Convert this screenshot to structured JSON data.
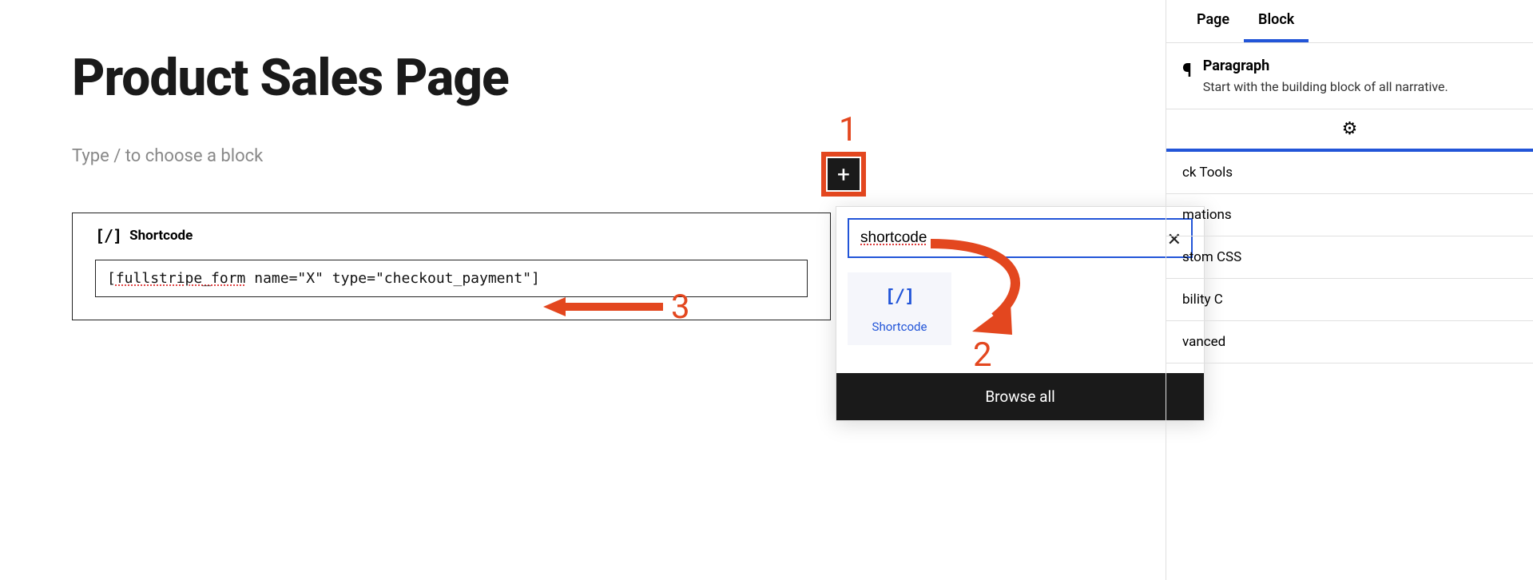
{
  "editor": {
    "page_title": "Product Sales Page",
    "placeholder": "Type / to choose a block",
    "shortcode_block": {
      "label": "Shortcode",
      "icon_text": "[/]",
      "input_value": "[fullstripe_form name=\"X\" type=\"checkout_payment\"]",
      "input_underlined": "fullstripe_form"
    }
  },
  "inserter": {
    "add_button": "+",
    "search_value": "shortcode",
    "close_icon": "✕",
    "result": {
      "icon_text": "[/]",
      "label": "Shortcode"
    },
    "browse_all": "Browse all"
  },
  "annotations": {
    "n1": "1",
    "n2": "2",
    "n3": "3",
    "color": "#e3471f"
  },
  "sidebar": {
    "tabs": {
      "page": "Page",
      "block": "Block"
    },
    "block_info": {
      "icon": "¶",
      "title": "Paragraph",
      "desc": "Start with the building block of all narrative."
    },
    "gear_icon": "⚙",
    "sections": {
      "block_tools": "ck Tools",
      "mations": "mations",
      "custom_css": "stom CSS",
      "bility": "bility C",
      "vanced": "vanced"
    }
  }
}
